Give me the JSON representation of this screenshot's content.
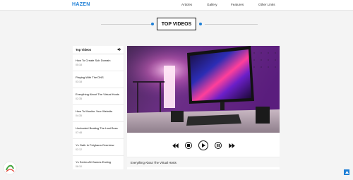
{
  "header": {
    "logo": "HAZEN",
    "nav": [
      "Articles",
      "Gallery",
      "Features",
      "Other Links"
    ]
  },
  "section": {
    "title": "TOP VIDEOS"
  },
  "playlist": {
    "title": "Top Videos",
    "items": [
      {
        "title": "How To Create Sub Domain",
        "time": "05:18"
      },
      {
        "title": "Playing With The DNS",
        "time": "03:18"
      },
      {
        "title": "Everything About The Virtual Hosts",
        "time": "02:35"
      },
      {
        "title": "How To Monitor Your Website",
        "time": "04:35"
      },
      {
        "title": "Uncharted Beating The Last Boss",
        "time": "07:48"
      },
      {
        "title": "Ys Oath In Felghana Overview",
        "time": "02:12"
      },
      {
        "title": "Ys Series All Games Ending",
        "time": "08:10"
      }
    ]
  },
  "player": {
    "now_playing": "Everything About The Virtual Hosts",
    "icons": [
      "backward-icon",
      "stop-icon",
      "play-icon",
      "pause-icon",
      "forward-icon"
    ]
  },
  "colors": {
    "accent": "#1e7fd6",
    "text": "#111111",
    "background": "#f4f4f4"
  }
}
